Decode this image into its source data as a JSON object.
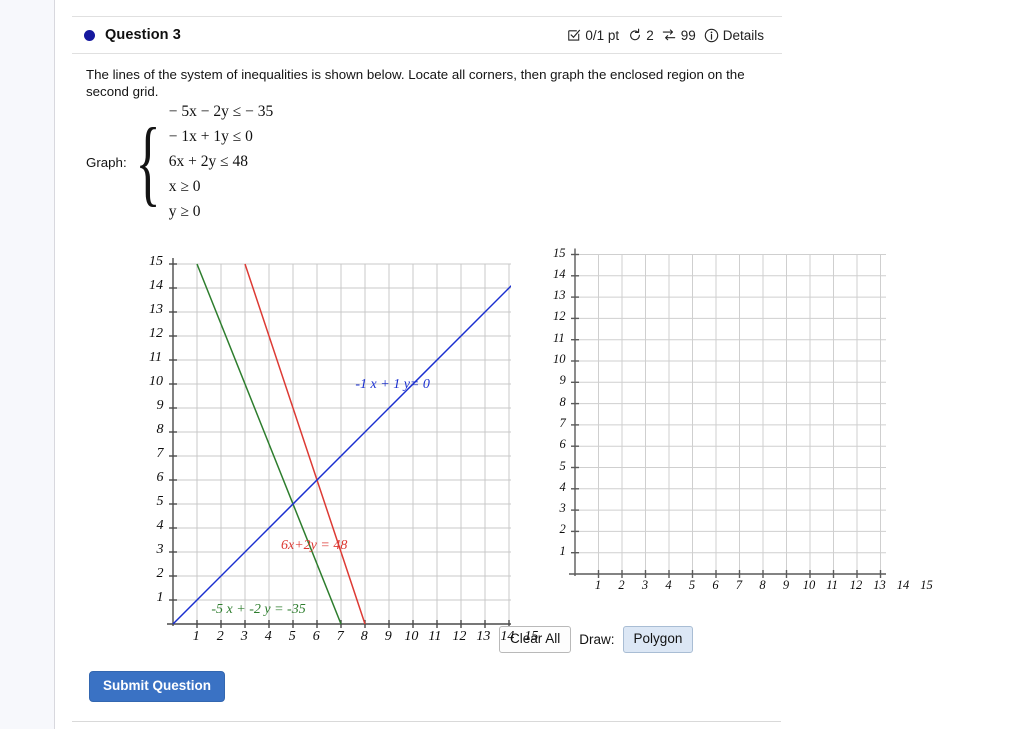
{
  "header": {
    "question_title": "Question 3",
    "dot_color": "#15189e",
    "points": "0/1 pt",
    "attempts": "2",
    "versions": "99",
    "details_label": "Details",
    "icons": {
      "checkbox": "checkbox-icon",
      "retry": "retry-icon",
      "shuffle": "shuffle-icon",
      "info": "info-icon"
    }
  },
  "prompt": {
    "text": "The lines of the system of inequalities is shown below. Locate all corners, then graph the enclosed region on the second grid."
  },
  "system": {
    "label": "Graph:",
    "inequalities": [
      "− 5x − 2y ≤  − 35",
      "− 1x + 1y ≤ 0",
      "6x + 2y ≤ 48",
      "x ≥ 0",
      "y ≥ 0"
    ]
  },
  "chart_data": [
    {
      "type": "line",
      "name": "lines-graph",
      "title": "",
      "xlabel": "",
      "ylabel": "",
      "xlim": [
        0,
        15
      ],
      "ylim": [
        0,
        15
      ],
      "xticks": [
        1,
        2,
        3,
        4,
        5,
        6,
        7,
        8,
        9,
        10,
        11,
        12,
        13,
        14,
        15
      ],
      "yticks": [
        1,
        2,
        3,
        4,
        5,
        6,
        7,
        8,
        9,
        10,
        11,
        12,
        13,
        14,
        15
      ],
      "grid": true,
      "legend": "inline-labels",
      "series": [
        {
          "name": "-5 x + -2 y = -35",
          "label": "-5 x + -2 y = -35",
          "color": "#2d7d2d",
          "equation": "-5x - 2y = -35",
          "slope": -2.5,
          "intercept": 17.5,
          "points": [
            [
              1,
              15
            ],
            [
              7,
              0
            ]
          ],
          "label_x": 4.1,
          "label_y": 0.55
        },
        {
          "name": "6x+2y = 48",
          "label": "6x+2y = 48",
          "color": "#dd3a34",
          "equation": "6x + 2y = 48",
          "slope": -3,
          "intercept": 24,
          "points": [
            [
              3,
              15
            ],
            [
              8,
              0
            ]
          ],
          "label_x": 7.0,
          "label_y": 3.2
        },
        {
          "name": "-1 x + 1 y= 0",
          "label": "-1 x + 1 y= 0",
          "color": "#1a2fd0",
          "equation": "-1x + 1y = 0",
          "slope": 1,
          "intercept": 0,
          "points": [
            [
              0,
              0
            ],
            [
              15,
              15
            ]
          ],
          "label_x": 10.1,
          "label_y": 9.9
        }
      ],
      "corner_points": [
        [
          5,
          5
        ],
        [
          6,
          6
        ]
      ]
    },
    {
      "type": "line",
      "name": "answer-grid",
      "title": "",
      "xlabel": "",
      "ylabel": "",
      "xlim": [
        0,
        15
      ],
      "ylim": [
        0,
        15
      ],
      "xticks": [
        1,
        2,
        3,
        4,
        5,
        6,
        7,
        8,
        9,
        10,
        11,
        12,
        13,
        14,
        15
      ],
      "yticks": [
        1,
        2,
        3,
        4,
        5,
        6,
        7,
        8,
        9,
        10,
        11,
        12,
        13,
        14,
        15
      ],
      "grid": true,
      "series": []
    }
  ],
  "toolbar": {
    "clear_all_label": "Clear All",
    "draw_label": "Draw:",
    "polygon_label": "Polygon",
    "selected_tool": "Polygon",
    "selected_color": "#dce7f5"
  },
  "submit": {
    "label": "Submit Question",
    "color": "#3a72c4"
  }
}
